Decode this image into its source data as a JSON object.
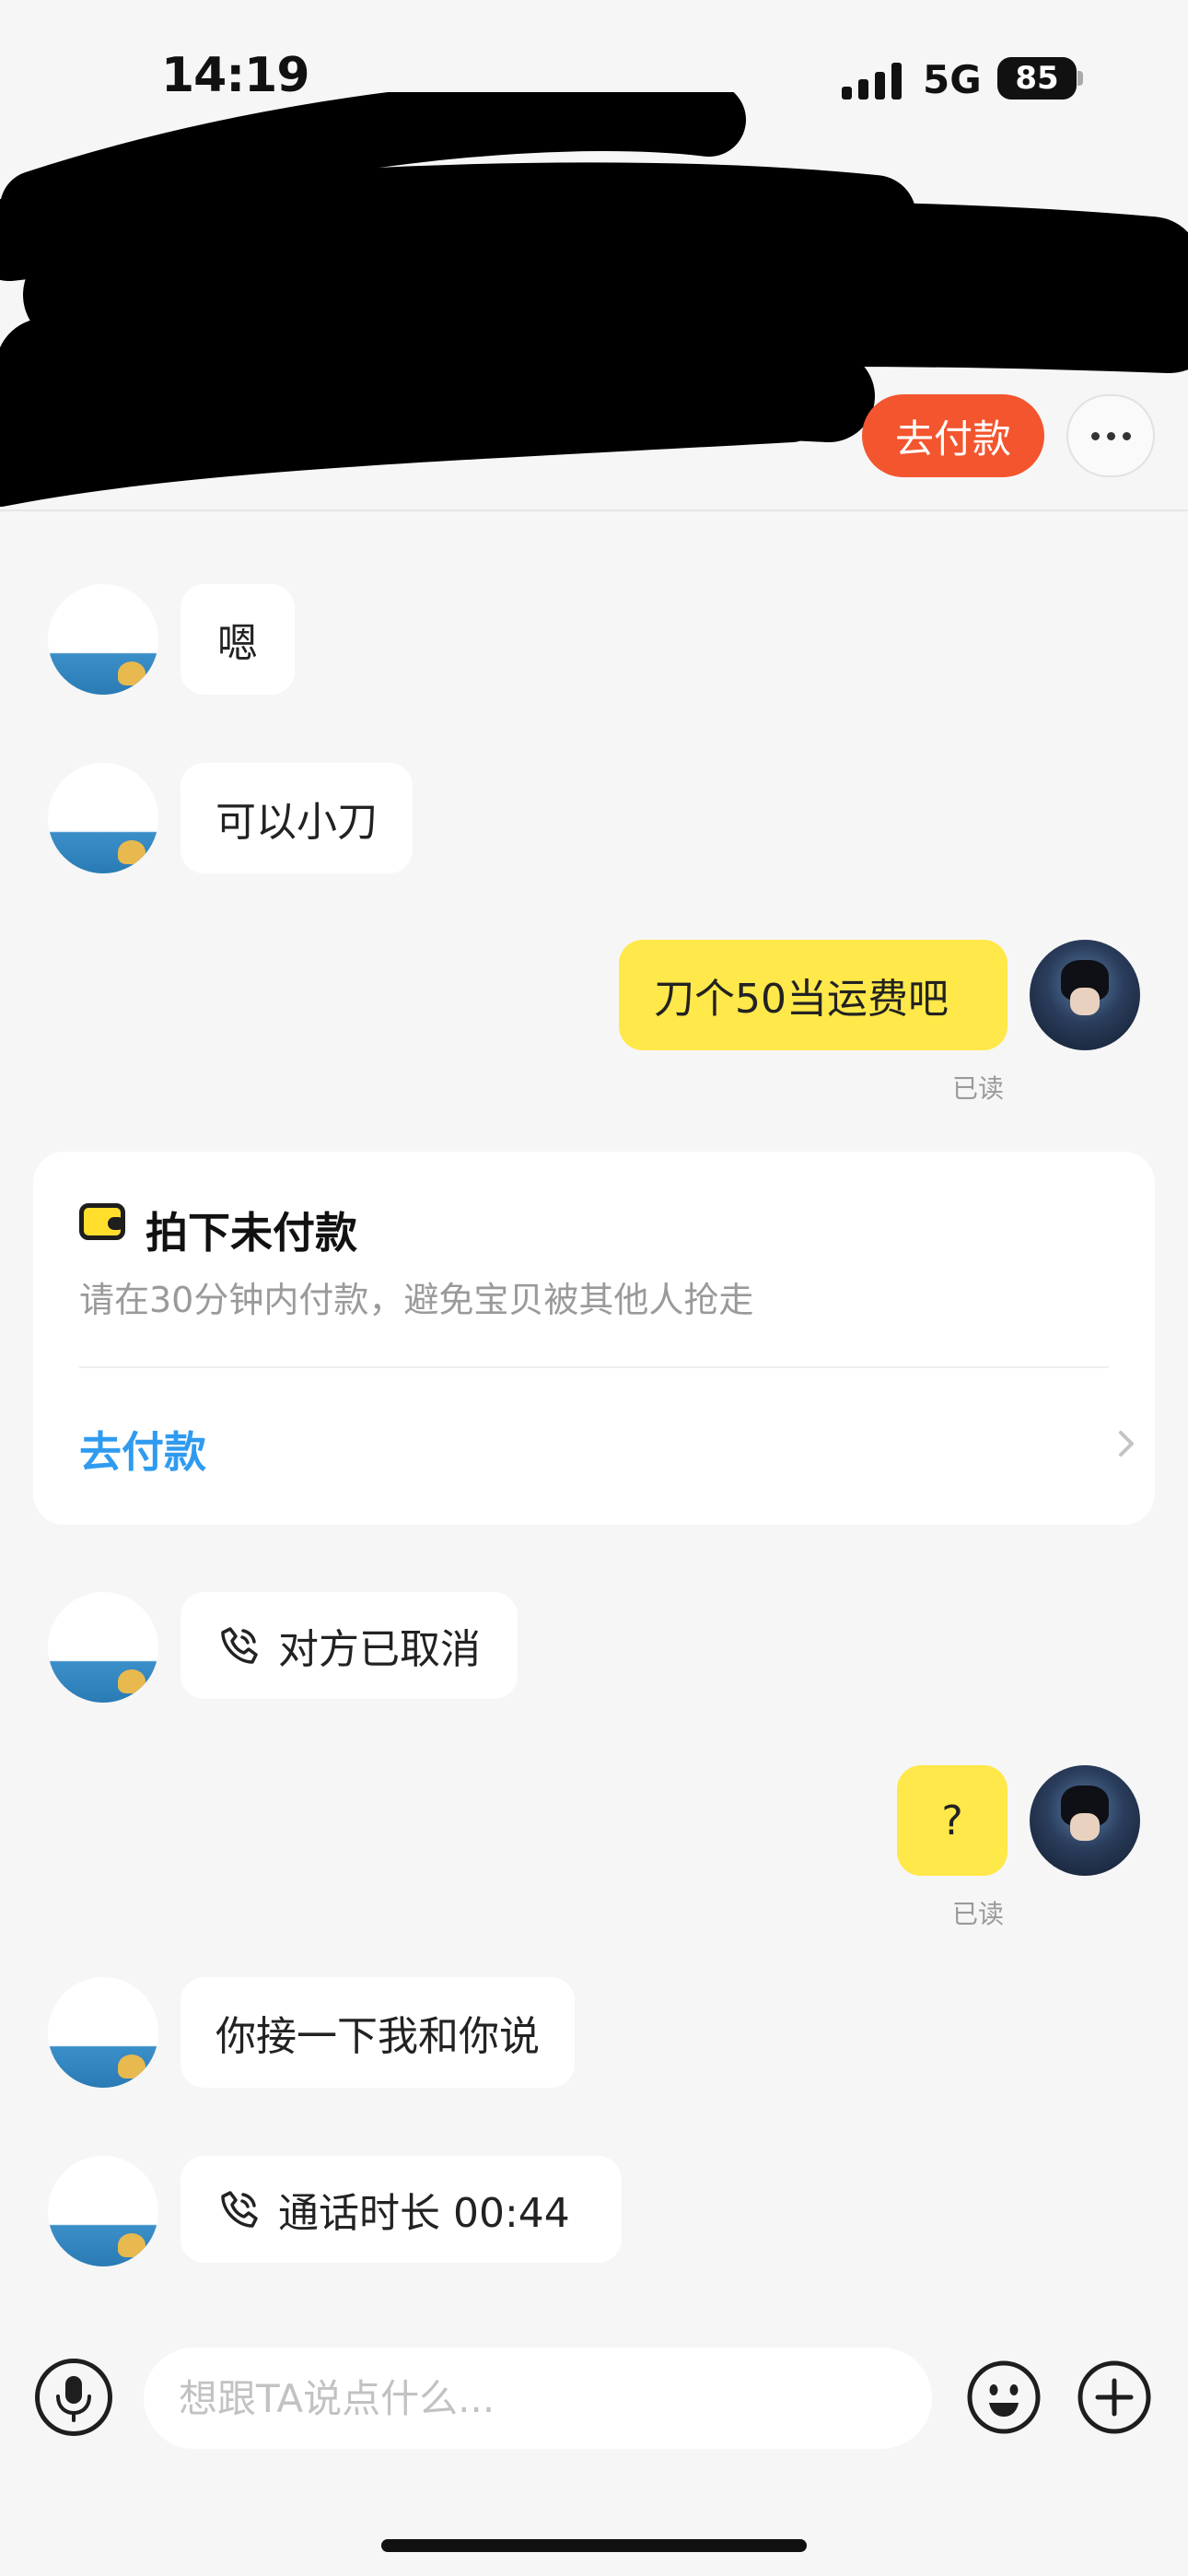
{
  "status_bar": {
    "time": "14:19",
    "network": "5G",
    "battery": "85"
  },
  "header": {
    "pay_button": "去付款"
  },
  "messages": [
    {
      "from": "other",
      "text": "嗯"
    },
    {
      "from": "other",
      "text": "可以小刀"
    },
    {
      "from": "me",
      "text": "刀个50当运费吧",
      "status": "已读"
    },
    {
      "from": "other",
      "type": "call",
      "text": "对方已取消"
    },
    {
      "from": "me",
      "text": "?",
      "status": "已读"
    },
    {
      "from": "other",
      "text": "你接一下我和你说"
    },
    {
      "from": "other",
      "type": "call",
      "text": "通话时长 00:44"
    }
  ],
  "order_card": {
    "title": "拍下未付款",
    "subtitle": "请在30分钟内付款，避免宝贝被其他人抢走",
    "action": "去付款"
  },
  "input_bar": {
    "placeholder": "想跟TA说点什么..."
  },
  "colors": {
    "background": "#f6f6f6",
    "my_bubble": "#ffe84a",
    "pay_button": "#f3552e",
    "link_blue": "#2f9bf0"
  },
  "icons": [
    "signal-icon",
    "battery-icon",
    "more-icon",
    "wallet-icon",
    "phone-call-icon",
    "chevron-right-icon",
    "microphone-icon",
    "emoji-icon",
    "plus-icon"
  ]
}
